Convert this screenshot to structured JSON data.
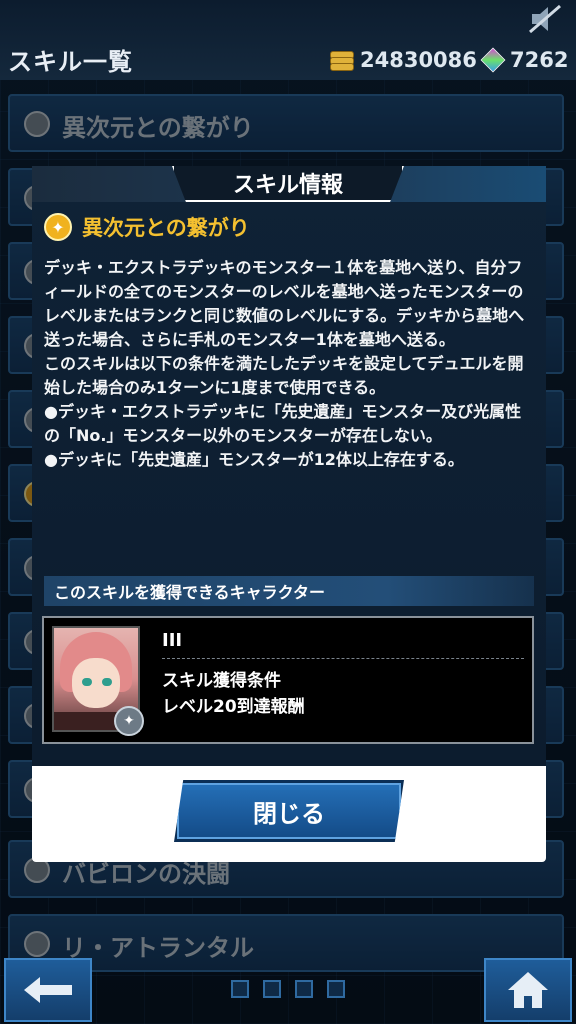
{
  "header": {
    "title": "スキル一覧",
    "gold": "24830086",
    "gems": "7262"
  },
  "list": {
    "items": [
      "異次元との繋がり",
      "",
      "",
      "",
      "",
      "",
      "",
      "",
      "",
      "",
      "",
      "",
      "バビロンの決闘",
      "リ・アトランタル"
    ]
  },
  "modal": {
    "title": "スキル情報",
    "skill_name": "異次元との繋がり",
    "description": [
      "デッキ・エクストラデッキのモンスター１体を墓地へ送り、自分フィールドの全てのモンスターのレベルを墓地へ送ったモンスターのレベルまたはランクと同じ数値のレベルにする。デッキから墓地へ送った場合、さらに手札のモンスター1体を墓地へ送る。",
      "このスキルは以下の条件を満たしたデッキを設定してデュエルを開始した場合のみ1ターンに1度まで使用できる。",
      "●デッキ・エクストラデッキに「先史遺産」モンスター及び光属性の「No.」モンスター以外のモンスターが存在しない。",
      "●デッキに「先史遺産」モンスターが12体以上存在する。"
    ],
    "character_section_title": "このスキルを獲得できるキャラクター",
    "character": {
      "name": "III",
      "condition_label": "スキル獲得条件",
      "condition_value": "レベル20到達報酬"
    },
    "close_label": "閉じる"
  },
  "colors": {
    "accent": "#f4c030",
    "button_blue": "#2570b8"
  }
}
